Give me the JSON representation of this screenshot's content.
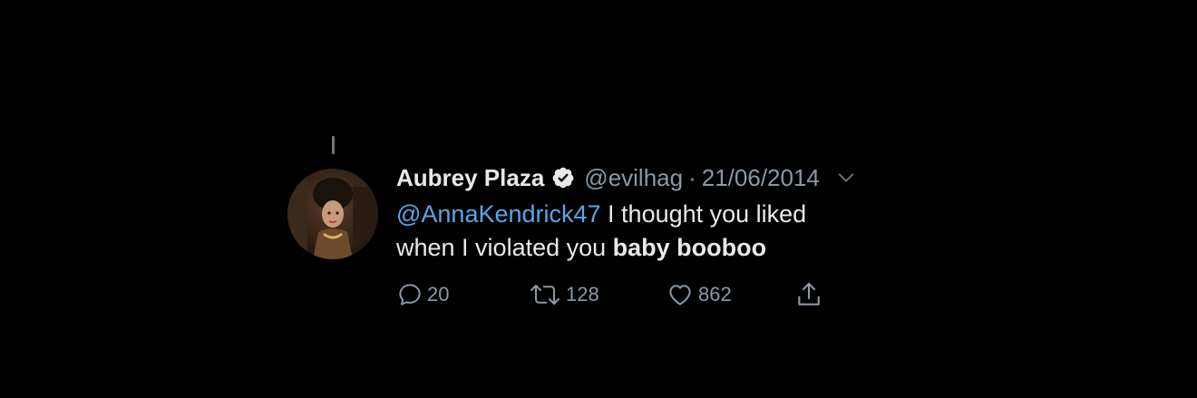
{
  "tweet": {
    "author_name": "Aubrey Plaza",
    "handle": "@evilhag",
    "separator": "·",
    "date": "21/06/2014",
    "mention": "@AnnaKendrick47",
    "text_part1": " I thought you liked",
    "text_part2": "when I violated you ",
    "text_bold": "baby booboo"
  },
  "actions": {
    "reply_count": "20",
    "retweet_count": "128",
    "like_count": "862"
  },
  "icons": {
    "verified": "verified-badge-icon",
    "caret": "chevron-down-icon",
    "reply": "reply-icon",
    "retweet": "retweet-icon",
    "like": "heart-icon",
    "share": "share-icon"
  },
  "colors": {
    "background": "#000000",
    "text": "#e7e9ea",
    "secondary": "#8b98a5",
    "mention": "#5aa6e6"
  }
}
